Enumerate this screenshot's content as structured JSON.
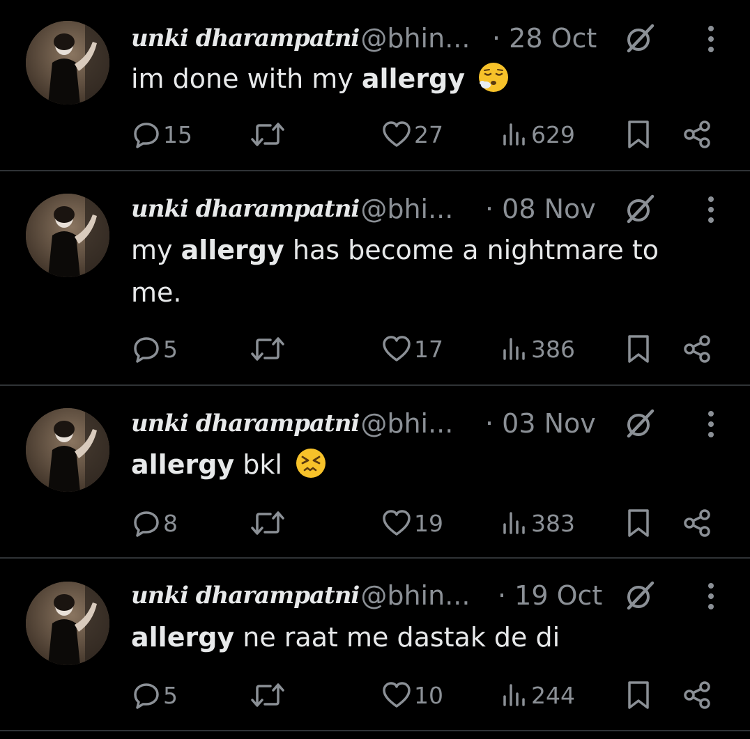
{
  "tweets": [
    {
      "display_name": "unki dharampatni",
      "handle": "@bhin...",
      "date": "· 28 Oct",
      "text_parts": [
        "im done with my ",
        "allergy",
        " "
      ],
      "emoji": "exhaling-face",
      "replies": "15",
      "likes": "27",
      "views": "629"
    },
    {
      "display_name": "unki dharampatni",
      "handle": "@bhi...",
      "date": "· 08 Nov",
      "text_parts": [
        "my ",
        "allergy",
        " has become a nightmare to me."
      ],
      "emoji": "",
      "replies": "5",
      "likes": "17",
      "views": "386"
    },
    {
      "display_name": "unki dharampatni",
      "handle": "@bhi...",
      "date": "· 03 Nov",
      "text_parts": [
        "",
        "allergy",
        " bkl "
      ],
      "emoji": "persevering-face",
      "replies": "8",
      "likes": "19",
      "views": "383"
    },
    {
      "display_name": "unki dharampatni",
      "handle": "@bhin...",
      "date": "· 19 Oct",
      "text_parts": [
        "",
        "allergy",
        " ne raat me dastak de di"
      ],
      "emoji": "",
      "replies": "5",
      "likes": "10",
      "views": "244"
    }
  ],
  "colors": {
    "background": "#000000",
    "text": "#e7e9ea",
    "muted": "#8b9096",
    "divider": "#2f3336"
  },
  "icons": {
    "reply": "reply-icon",
    "retweet": "retweet-icon",
    "like": "heart-icon",
    "views": "views-icon",
    "bookmark": "bookmark-icon",
    "share": "share-icon",
    "grok": "grok-icon",
    "more": "more-vertical-icon"
  }
}
